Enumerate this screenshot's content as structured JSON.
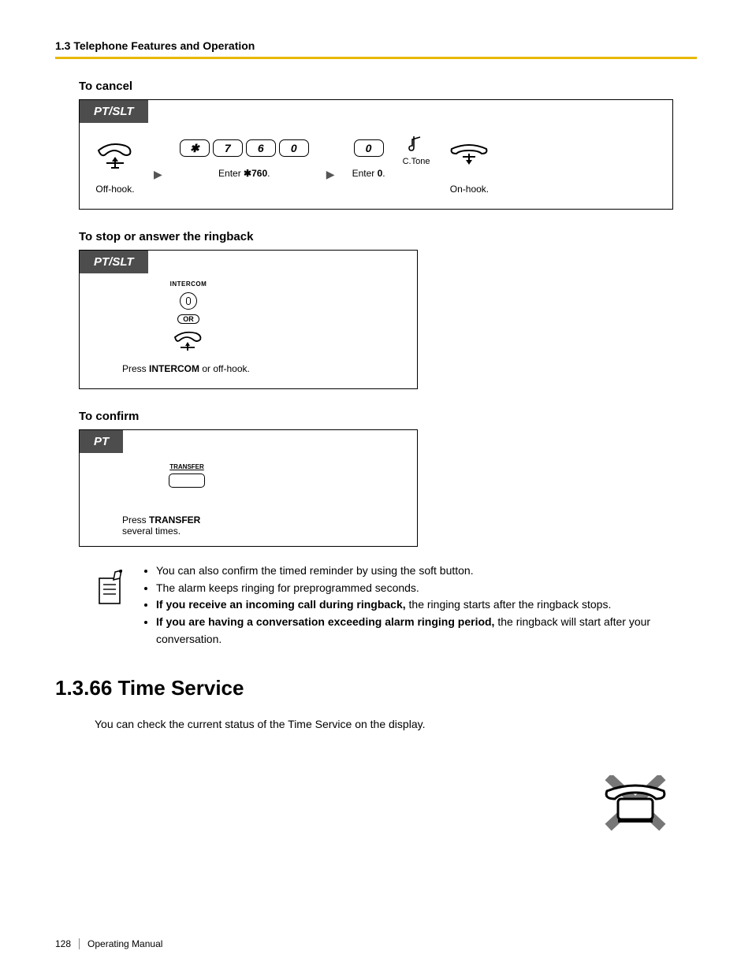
{
  "header": {
    "title": "1.3 Telephone Features and Operation"
  },
  "sub1": "To cancel",
  "box1": {
    "label": "PT/SLT",
    "step1": "Off-hook.",
    "keys": [
      "✱",
      "7",
      "6",
      "0"
    ],
    "step2_pre": "Enter ",
    "step2_code": "✱760",
    "step2_post": ".",
    "zerokey": "0",
    "step3_pre": "Enter ",
    "step3_code": "0",
    "step3_post": ".",
    "ctone": "C.Tone",
    "step4": "On-hook."
  },
  "sub2": "To stop or answer the ringback",
  "box2": {
    "label": "PT/SLT",
    "intercom": "INTERCOM",
    "or": "OR",
    "cap_pre": "Press ",
    "cap_b": "INTERCOM",
    "cap_post": " or off-hook."
  },
  "sub3": "To confirm",
  "box3": {
    "label": "PT",
    "transfer": "TRANSFER",
    "cap_pre": "Press ",
    "cap_b": "TRANSFER",
    "cap_post": "several times."
  },
  "notes": {
    "b1": "You can also confirm the timed reminder by using the soft button.",
    "b2": "The alarm keeps ringing for preprogrammed seconds.",
    "b3_b": "If you receive an incoming call during ringback,",
    "b3_r": " the ringing starts after the ringback stops.",
    "b4_b": "If you are having a conversation exceeding alarm ringing period,",
    "b4_r": " the ringback will start after your conversation."
  },
  "section": {
    "head": "1.3.66  Time Service",
    "para": "You can check the current status of the Time Service on the display."
  },
  "footer": {
    "page": "128",
    "label": "Operating Manual"
  }
}
